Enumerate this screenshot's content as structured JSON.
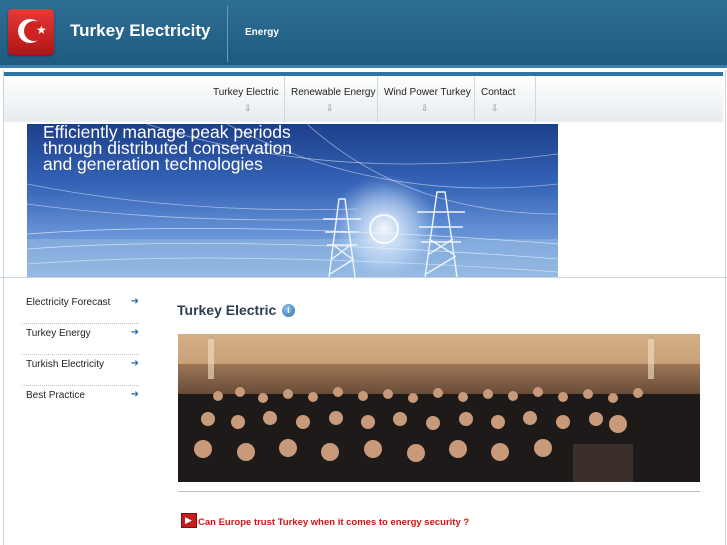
{
  "header": {
    "site_title": "Turkey Electricity",
    "subtitle": "Energy",
    "logo_icon": "turkey-flag-icon"
  },
  "nav": {
    "items": [
      {
        "label": "Turkey Electric",
        "icon": "down-arrow-icon"
      },
      {
        "label": "Renewable Energy",
        "icon": "down-arrow-icon"
      },
      {
        "label": "Wind Power Turkey",
        "icon": "down-arrow-icon"
      },
      {
        "label": "Contact",
        "icon": "down-arrow-icon"
      }
    ]
  },
  "banner": {
    "line1": "Efficiently manage peak periods",
    "line2": "through distributed conservation",
    "line3": "and generation technologies"
  },
  "sidebar": {
    "items": [
      {
        "label": "Electricity Forecast",
        "icon": "right-arrow-icon"
      },
      {
        "label": "Turkey Energy",
        "icon": "right-arrow-icon"
      },
      {
        "label": "Turkish Electricity",
        "icon": "right-arrow-icon"
      },
      {
        "label": "Best Practice",
        "icon": "right-arrow-icon"
      }
    ]
  },
  "main": {
    "title": "Turkey Electric",
    "title_icon": "info-icon",
    "news_link": "Can Europe trust Turkey when it comes to energy security ?",
    "news_icon": "play-icon"
  },
  "colors": {
    "header_bg": "#2a6890",
    "nav_accent": "#2b74a6",
    "link_red": "#d11414",
    "sidebar_arrow": "#2c6aa0"
  }
}
